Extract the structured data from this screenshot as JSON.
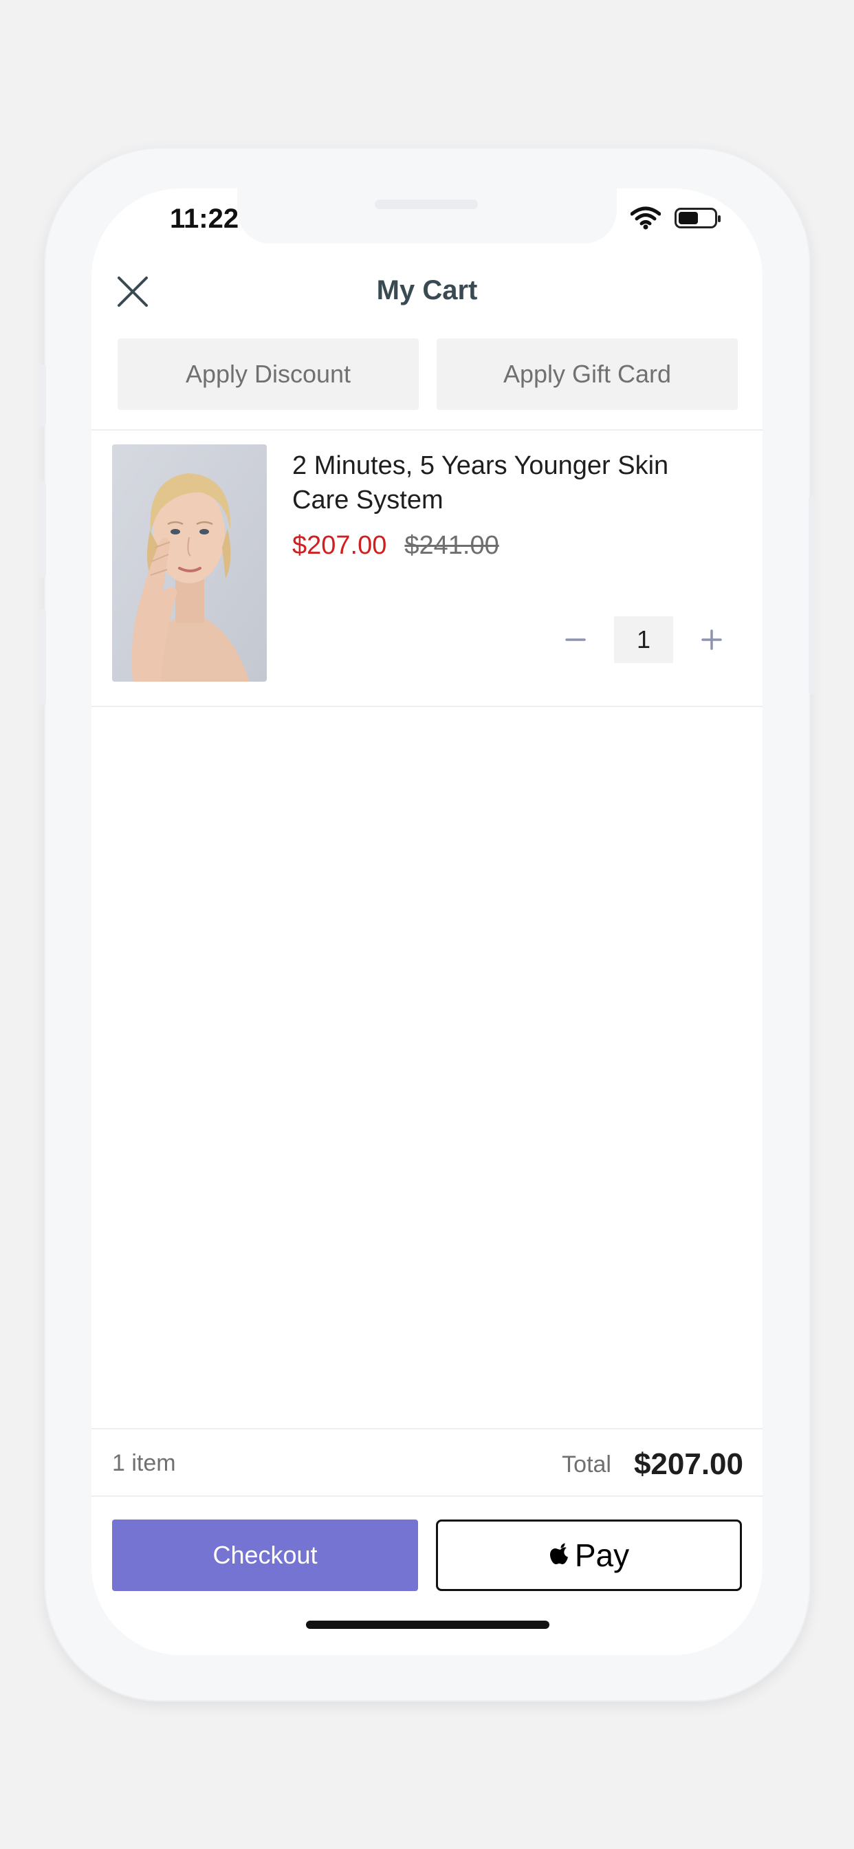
{
  "status_bar": {
    "time": "11:22",
    "wifi_icon": "wifi-icon",
    "battery_icon": "battery-icon",
    "battery_level": 0.55
  },
  "header": {
    "title": "My Cart",
    "close_icon": "close-icon"
  },
  "actions": {
    "discount_label": "Apply Discount",
    "gift_card_label": "Apply Gift Card"
  },
  "cart": {
    "items": [
      {
        "name": "2 Minutes, 5 Years Younger Skin Care System",
        "price": "$207.00",
        "original_price": "$241.00",
        "quantity": "1",
        "image": "woman-skincare-photo"
      }
    ]
  },
  "summary": {
    "item_count": "1 item",
    "total_label": "Total",
    "total_value": "$207.00"
  },
  "checkout": {
    "checkout_label": "Checkout",
    "applepay_label": "Pay",
    "apple_icon": "apple-logo-icon"
  },
  "colors": {
    "accent": "#7574d3",
    "sale_price": "#cf1f1f",
    "title": "#3a4a52"
  }
}
